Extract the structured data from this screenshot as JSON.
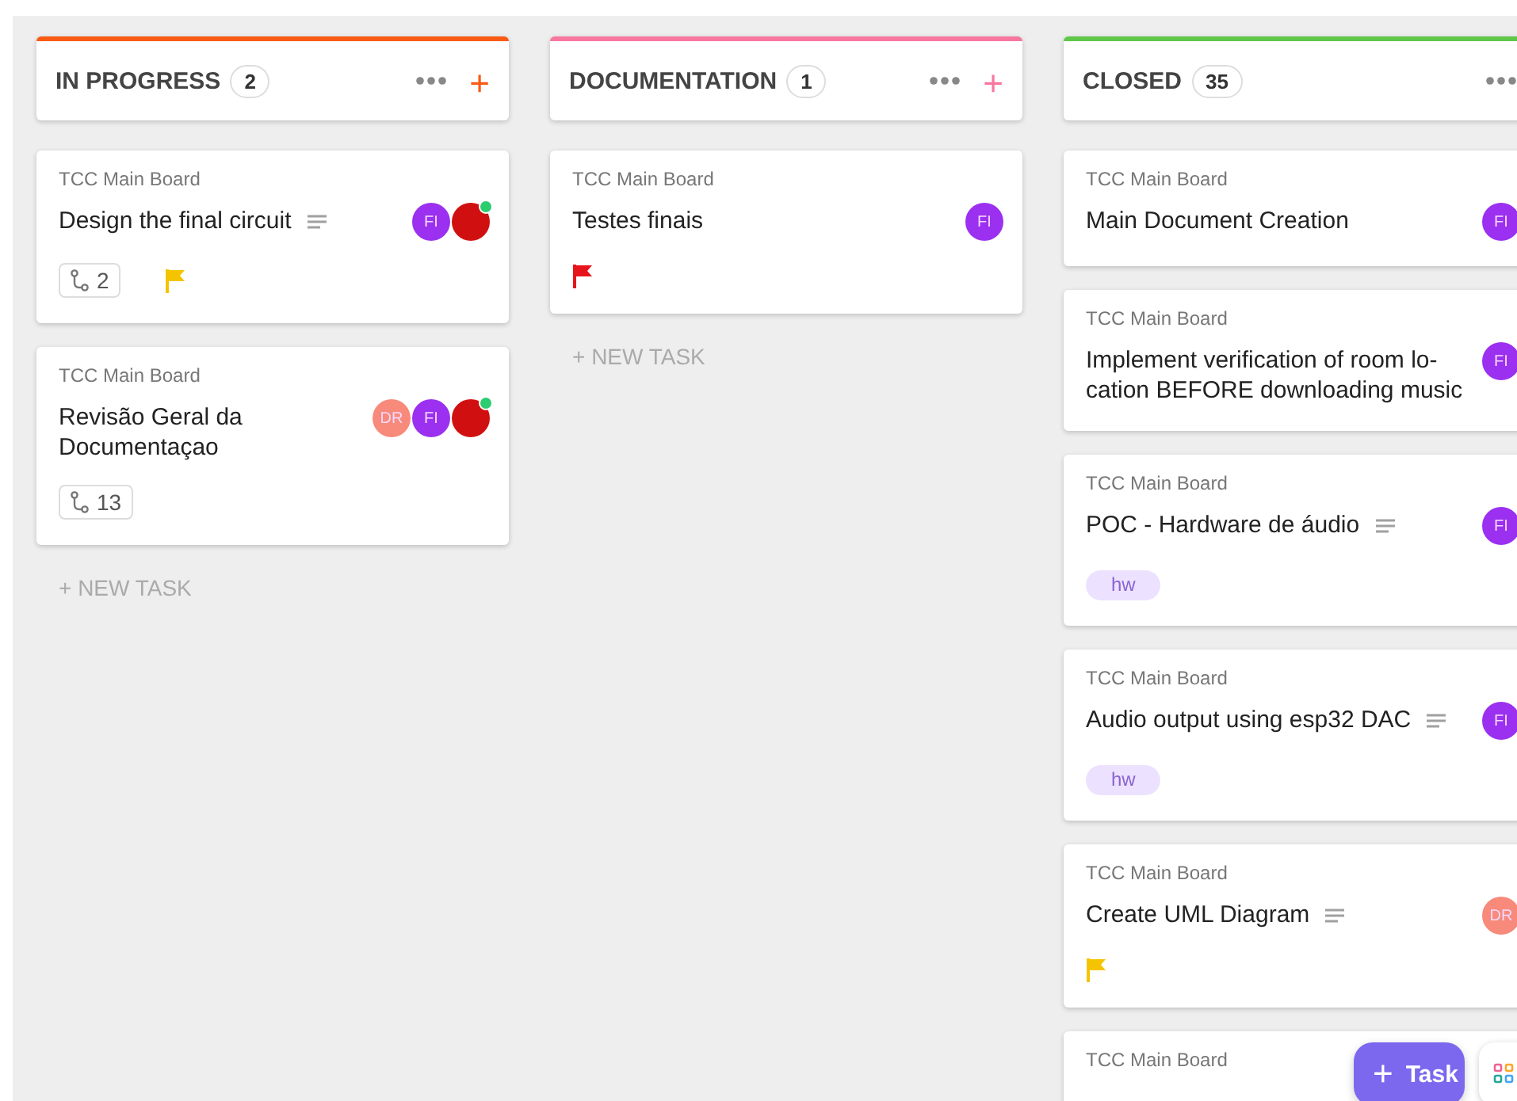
{
  "columns": [
    {
      "name": "IN PROGRESS",
      "count": "2",
      "color": "#fa5a14",
      "add": "+",
      "new_task": "+ NEW TASK",
      "cards": [
        {
          "board": "TCC Main Board",
          "title": "Design the final circuit",
          "description": true,
          "subtasks": "2",
          "flag": {
            "color": "#f5c400"
          },
          "avatars": [
            {
              "initials": "FI",
              "color": "#9b30f0",
              "online": false
            },
            {
              "color": "#d01010",
              "online": true
            }
          ]
        },
        {
          "board": "TCC Main Board",
          "title": "Revisão Geral da Documentaçao",
          "subtasks": "13",
          "avatars": [
            {
              "initials": "DR",
              "color": "#f78a7a",
              "online": false
            },
            {
              "initials": "FI",
              "color": "#9b30f0",
              "online": false
            },
            {
              "color": "#d01010",
              "online": true
            }
          ]
        }
      ]
    },
    {
      "name": "DOCUMENTATION",
      "count": "1",
      "color": "#f7779f",
      "add": "+",
      "new_task": "+ NEW TASK",
      "cards": [
        {
          "board": "TCC Main Board",
          "title": "Testes finais",
          "flag": {
            "color": "#e8141b"
          },
          "avatars": [
            {
              "initials": "FI",
              "color": "#9b30f0",
              "online": false
            }
          ]
        }
      ]
    },
    {
      "name": "CLOSED",
      "count": "35",
      "color": "#5fc74a",
      "cards": [
        {
          "board": "TCC Main Board",
          "title": "Main Document Creation",
          "avatars": [
            {
              "initials": "FI",
              "color": "#9b30f0",
              "online": false
            }
          ]
        },
        {
          "board": "TCC Main Board",
          "title": "Implement verification of room lo-cation BEFORE downloading music",
          "avatars": [
            {
              "initials": "FI",
              "color": "#9b30f0",
              "online": false
            }
          ]
        },
        {
          "board": "TCC Main Board",
          "title": "POC - Hardware de áudio",
          "description": true,
          "tags": [
            "hw"
          ],
          "avatars": [
            {
              "initials": "FI",
              "color": "#9b30f0",
              "online": false
            }
          ]
        },
        {
          "board": "TCC Main Board",
          "title": "Audio output using esp32 DAC",
          "description": true,
          "tags": [
            "hw"
          ],
          "avatars": [
            {
              "initials": "FI",
              "color": "#9b30f0",
              "online": false
            }
          ]
        },
        {
          "board": "TCC Main Board",
          "title": "Create UML Diagram",
          "description": true,
          "flag": {
            "color": "#f5c400"
          },
          "avatars": [
            {
              "initials": "DR",
              "color": "#f78a7a",
              "online": false
            }
          ]
        },
        {
          "board": "TCC Main Board"
        }
      ]
    }
  ],
  "task_button": {
    "icon": "+",
    "label": "Task"
  }
}
